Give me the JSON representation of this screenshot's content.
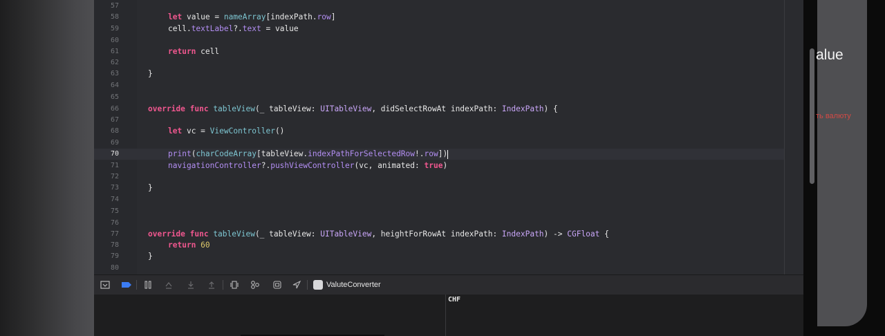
{
  "editor": {
    "current_line": "70",
    "lines": [
      {
        "num": "57",
        "code": ""
      },
      {
        "num": "58",
        "code": "let value = nameArray[indexPath.row]"
      },
      {
        "num": "59",
        "code": "cell.textLabel?.text = value"
      },
      {
        "num": "60",
        "code": ""
      },
      {
        "num": "61",
        "code": "return cell"
      },
      {
        "num": "62",
        "code": ""
      },
      {
        "num": "63",
        "code": "}"
      },
      {
        "num": "64",
        "code": ""
      },
      {
        "num": "65",
        "code": ""
      },
      {
        "num": "66",
        "code": "override func tableView(_ tableView: UITableView, didSelectRowAt indexPath: IndexPath) {"
      },
      {
        "num": "67",
        "code": ""
      },
      {
        "num": "68",
        "code": "let vc = ViewController()"
      },
      {
        "num": "69",
        "code": ""
      },
      {
        "num": "70",
        "code": "print(charCodeArray[tableView.indexPathForSelectedRow!.row])"
      },
      {
        "num": "71",
        "code": "navigationController?.pushViewController(vc, animated: true)"
      },
      {
        "num": "72",
        "code": ""
      },
      {
        "num": "73",
        "code": "}"
      },
      {
        "num": "74",
        "code": ""
      },
      {
        "num": "75",
        "code": ""
      },
      {
        "num": "76",
        "code": ""
      },
      {
        "num": "77",
        "code": "override func tableView(_ tableView: UITableView, heightForRowAt indexPath: IndexPath) -> CGFloat {"
      },
      {
        "num": "78",
        "code": "return 60"
      },
      {
        "num": "79",
        "code": "}"
      },
      {
        "num": "80",
        "code": ""
      }
    ]
  },
  "debug_bar": {
    "icons": [
      "hide-debug-area-icon",
      "breakpoints-toggle-icon",
      "pause-icon",
      "step-over-icon",
      "step-into-icon",
      "step-out-icon",
      "view-hierarchy-icon",
      "memory-graph-icon",
      "environment-overrides-icon",
      "simulate-location-icon"
    ],
    "scheme_label": "ValuteConverter"
  },
  "console": {
    "output": "CHF"
  },
  "simulator": {
    "title_fragment": "alue",
    "link_fragment": "ть валюту",
    "link_color": "#d54a45"
  },
  "colors": {
    "keyword": "#f0578f",
    "type": "#c9a6f8",
    "function": "#7ec6d2",
    "property": "#b38ef3",
    "number": "#dfc96b"
  }
}
